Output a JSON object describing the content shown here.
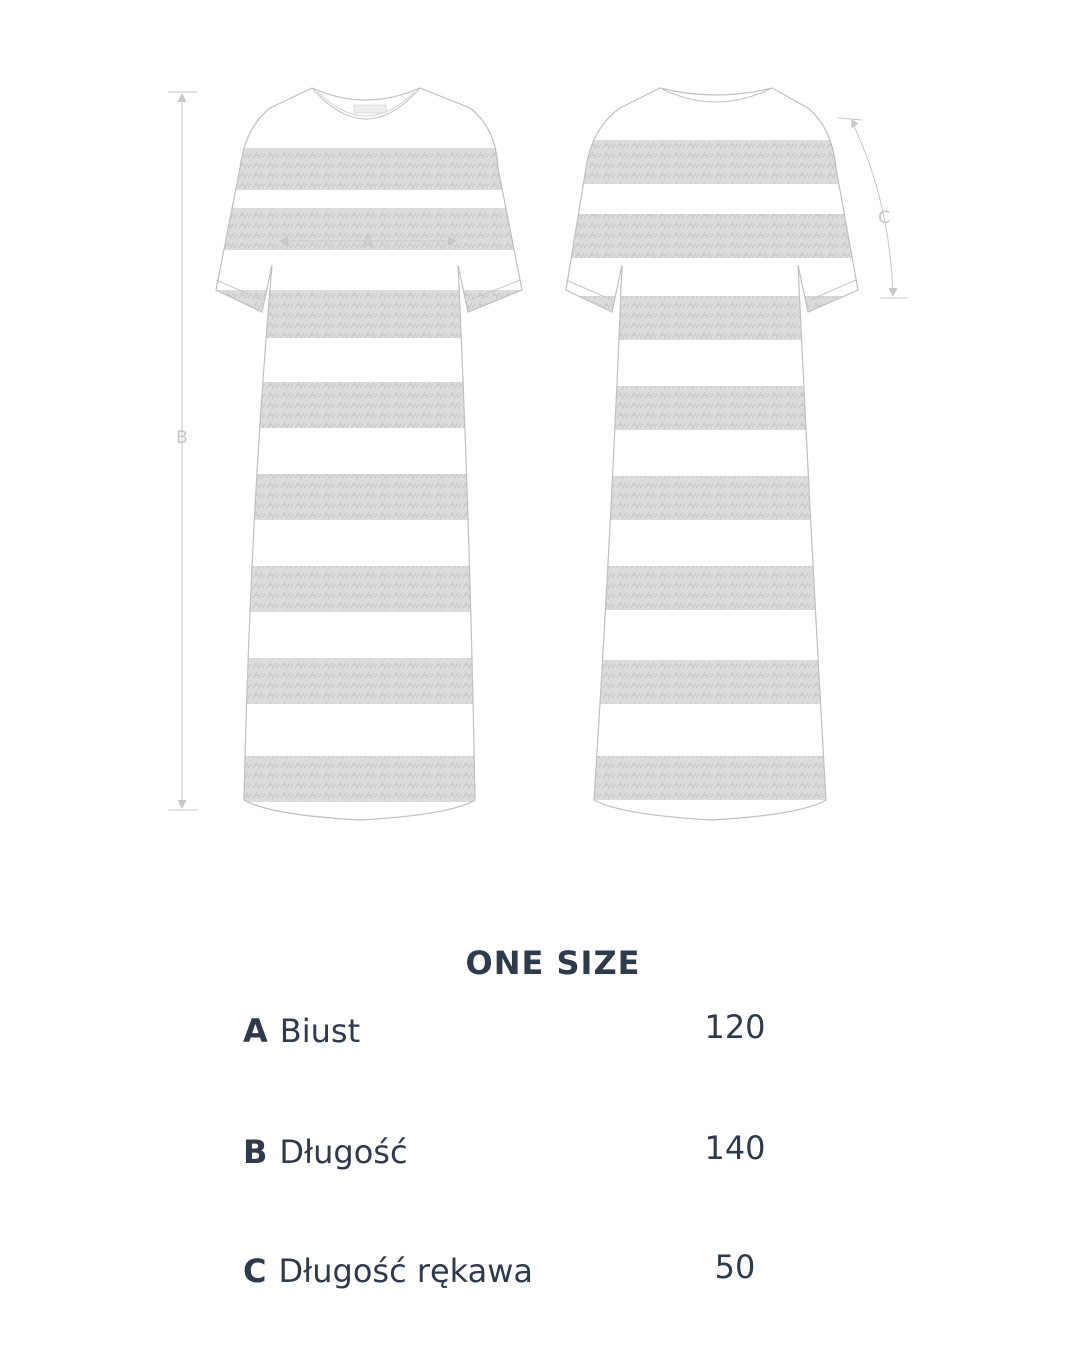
{
  "illustration": {
    "dimension_labels": {
      "a": "A",
      "b": "B",
      "c": "C"
    },
    "brand_tag": "MOHITO"
  },
  "size_table": {
    "title": "ONE SIZE",
    "rows": [
      {
        "letter": "A",
        "label": "Biust",
        "value": "120"
      },
      {
        "letter": "B",
        "label": "Długość",
        "value": "140"
      },
      {
        "letter": "C",
        "label": "Długość rękawa",
        "value": "50"
      }
    ]
  },
  "colors": {
    "text": "#2f3a4c",
    "sketch": "#c8c8c8",
    "stripe": "#d9d9d9"
  }
}
